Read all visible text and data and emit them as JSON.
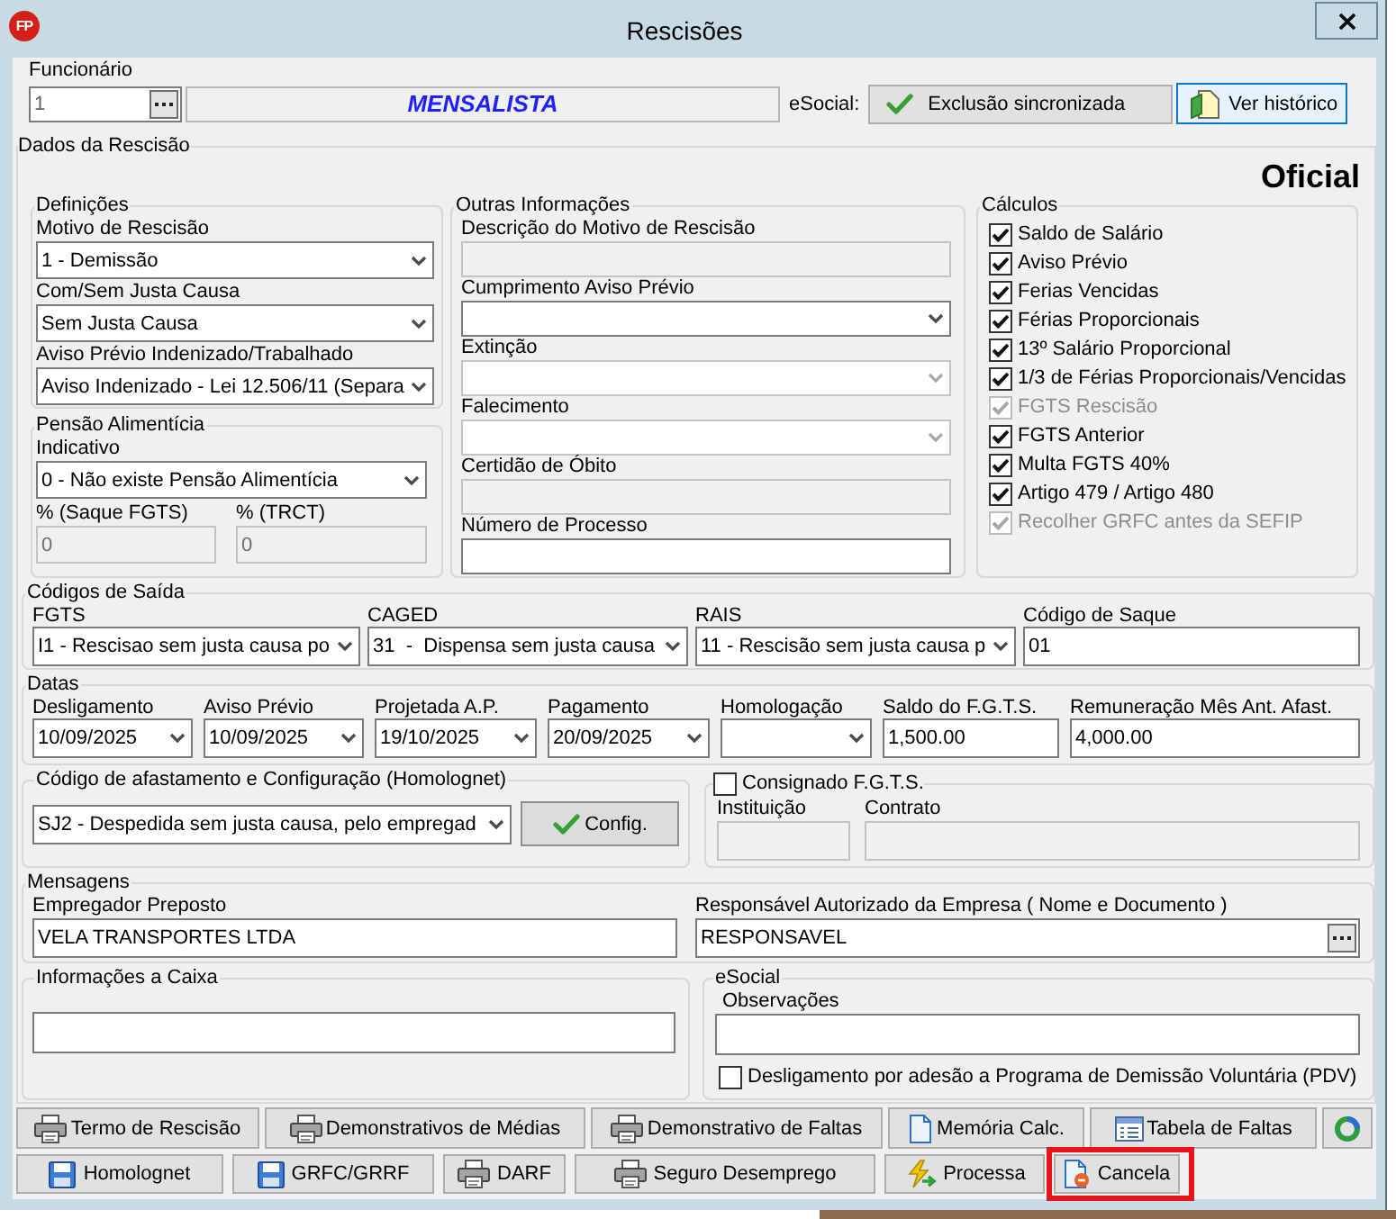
{
  "window": {
    "title": "Rescisões",
    "app_logo": "FP"
  },
  "header": {
    "employee": {
      "label": "Funcionário",
      "code": {
        "kind": "lookup",
        "value": "1",
        "disabled": false
      },
      "name": "MENSALISTA"
    },
    "esocial_sync": {
      "label": "eSocial:",
      "status": "Exclusão sincronizada",
      "history_button": {
        "label": "Ver histórico",
        "focused": true
      }
    }
  },
  "dados": {
    "title": "Dados da Rescisão",
    "type_label": "Oficial"
  },
  "definicoes": {
    "title": "Definições",
    "fields": [
      {
        "label": "Motivo de Rescisão",
        "kind": "select",
        "value": "1 - Demissão",
        "disabled": false
      },
      {
        "label": "Com/Sem Justa Causa",
        "kind": "select",
        "value": "Sem Justa Causa",
        "disabled": false
      },
      {
        "label": "Aviso Prévio Indenizado/Trabalhado",
        "kind": "select",
        "value": "Aviso Indenizado - Lei 12.506/11 (Separa",
        "disabled": false
      }
    ]
  },
  "pensao": {
    "title": "Pensão Alimentícia",
    "fields": [
      {
        "label": "Indicativo",
        "kind": "select",
        "value": "0 - Não existe Pensão Alimentícia",
        "disabled": false
      },
      {
        "label": "% (Saque FGTS)",
        "kind": "input",
        "value": "0",
        "disabled": true
      },
      {
        "label": "% (TRCT)",
        "kind": "input",
        "value": "0",
        "disabled": true
      }
    ]
  },
  "outras": {
    "title": "Outras Informações",
    "fields": [
      {
        "label": "Descrição do Motivo de Rescisão",
        "kind": "input",
        "disabled": true
      },
      {
        "label": "Cumprimento Aviso Prévio",
        "kind": "select",
        "disabled": false
      },
      {
        "label": "Extinção",
        "kind": "select",
        "disabled": true
      },
      {
        "label": "Falecimento",
        "kind": "select",
        "disabled": true
      },
      {
        "label": "Certidão de Óbito",
        "kind": "input",
        "disabled": true
      },
      {
        "label": "Número de Processo",
        "kind": "input",
        "disabled": false
      }
    ]
  },
  "calculos": {
    "title": "Cálculos",
    "items": [
      {
        "label": "Saldo de Salário",
        "checked": true,
        "disabled": false
      },
      {
        "label": "Aviso Prévio",
        "checked": true,
        "disabled": false
      },
      {
        "label": "Ferias Vencidas",
        "checked": true,
        "disabled": false
      },
      {
        "label": "Férias Proporcionais",
        "checked": true,
        "disabled": false
      },
      {
        "label": "13º Salário Proporcional",
        "checked": true,
        "disabled": false
      },
      {
        "label": "1/3 de Férias Proporcionais/Vencidas",
        "checked": true,
        "disabled": false
      },
      {
        "label": "FGTS Rescisão",
        "checked": true,
        "disabled": true
      },
      {
        "label": "FGTS Anterior",
        "checked": true,
        "disabled": false
      },
      {
        "label": "Multa FGTS 40%",
        "checked": true,
        "disabled": false
      },
      {
        "label": "Artigo 479 / Artigo 480",
        "checked": true,
        "disabled": false
      },
      {
        "label": "Recolher GRFC antes da SEFIP",
        "checked": true,
        "disabled": true
      }
    ]
  },
  "codigos_saida": {
    "title": "Códigos de Saída",
    "fields": [
      {
        "label": "FGTS",
        "kind": "select",
        "value": "I1 - Rescisao sem justa causa po",
        "disabled": false
      },
      {
        "label": "CAGED",
        "kind": "select",
        "value": "31  -  Dispensa sem justa causa",
        "disabled": false
      },
      {
        "label": "RAIS",
        "kind": "select",
        "value": "11 - Rescisão sem justa causa p",
        "disabled": false
      },
      {
        "label": "Código de Saque",
        "kind": "input",
        "value": "01",
        "disabled": false
      }
    ]
  },
  "datas": {
    "title": "Datas",
    "fields": [
      {
        "label": "Desligamento",
        "kind": "date",
        "value": "10/09/2025",
        "disabled": false
      },
      {
        "label": "Aviso Prévio",
        "kind": "date",
        "value": "10/09/2025",
        "disabled": false
      },
      {
        "label": "Projetada A.P.",
        "kind": "date",
        "value": "19/10/2025",
        "disabled": false
      },
      {
        "label": "Pagamento",
        "kind": "date",
        "value": "20/09/2025",
        "disabled": false
      },
      {
        "label": "Homologação",
        "kind": "date",
        "disabled": false
      },
      {
        "label": "Saldo do F.G.T.S.",
        "kind": "input",
        "value": "1,500.00",
        "disabled": false
      },
      {
        "label": "Remuneração Mês Ant. Afast.",
        "kind": "input",
        "value": "4,000.00",
        "disabled": false
      }
    ]
  },
  "afastamento": {
    "title": "Código de afastamento e Configuração (Homolognet)",
    "field": {
      "kind": "select",
      "value": "SJ2 - Despedida sem justa causa, pelo empregad",
      "disabled": false
    },
    "button": "Config."
  },
  "consignado": {
    "checkbox": {
      "label": "Consignado F.G.T.S.",
      "checked": false
    },
    "fields": [
      {
        "label": "Instituição",
        "kind": "input",
        "disabled": true
      },
      {
        "label": "Contrato",
        "kind": "input",
        "disabled": true
      }
    ]
  },
  "mensagens": {
    "title": "Mensagens",
    "fields": [
      {
        "label": "Empregador Preposto",
        "kind": "input",
        "value": "VELA TRANSPORTES LTDA",
        "disabled": false
      },
      {
        "label": "Responsável Autorizado da Empresa ( Nome e Documento )",
        "kind": "lookup",
        "value": "RESPONSAVEL",
        "disabled": false
      }
    ]
  },
  "informacoes_caixa": {
    "title": "Informações a Caixa",
    "field": {
      "kind": "input",
      "disabled": false
    }
  },
  "esocial": {
    "title": "eSocial",
    "fields": [
      {
        "label": "Observações",
        "kind": "input",
        "disabled": false
      }
    ],
    "pdv": {
      "label": "Desligamento por adesão a Programa de Demissão Voluntária (PDV)",
      "checked": false
    }
  },
  "toolbar": {
    "rows": [
      {
        "buttons": [
          {
            "label": "Termo de Rescisão",
            "kind": "printer",
            "highlighted": false
          },
          {
            "label": "Demonstrativos de Médias",
            "kind": "printer",
            "highlighted": false
          },
          {
            "label": "Demonstrativo de Faltas",
            "kind": "printer",
            "highlighted": false
          },
          {
            "label": "Memória Calc.",
            "kind": "document",
            "highlighted": false
          },
          {
            "label": "Tabela de Faltas",
            "kind": "table",
            "highlighted": false
          },
          {
            "kind": "ring",
            "highlighted": false
          }
        ]
      },
      {
        "buttons": [
          {
            "label": "Homolognet",
            "kind": "floppy",
            "highlighted": false
          },
          {
            "label": "GRFC/GRRF",
            "kind": "floppy",
            "highlighted": false
          },
          {
            "label": "DARF",
            "kind": "printer",
            "highlighted": false
          },
          {
            "label": "Seguro Desemprego",
            "kind": "printer",
            "highlighted": false
          },
          {
            "label": "Processa",
            "kind": "lightning",
            "highlighted": false
          },
          {
            "label": "Cancela",
            "kind": "cancel",
            "highlighted": true
          }
        ]
      }
    ]
  }
}
